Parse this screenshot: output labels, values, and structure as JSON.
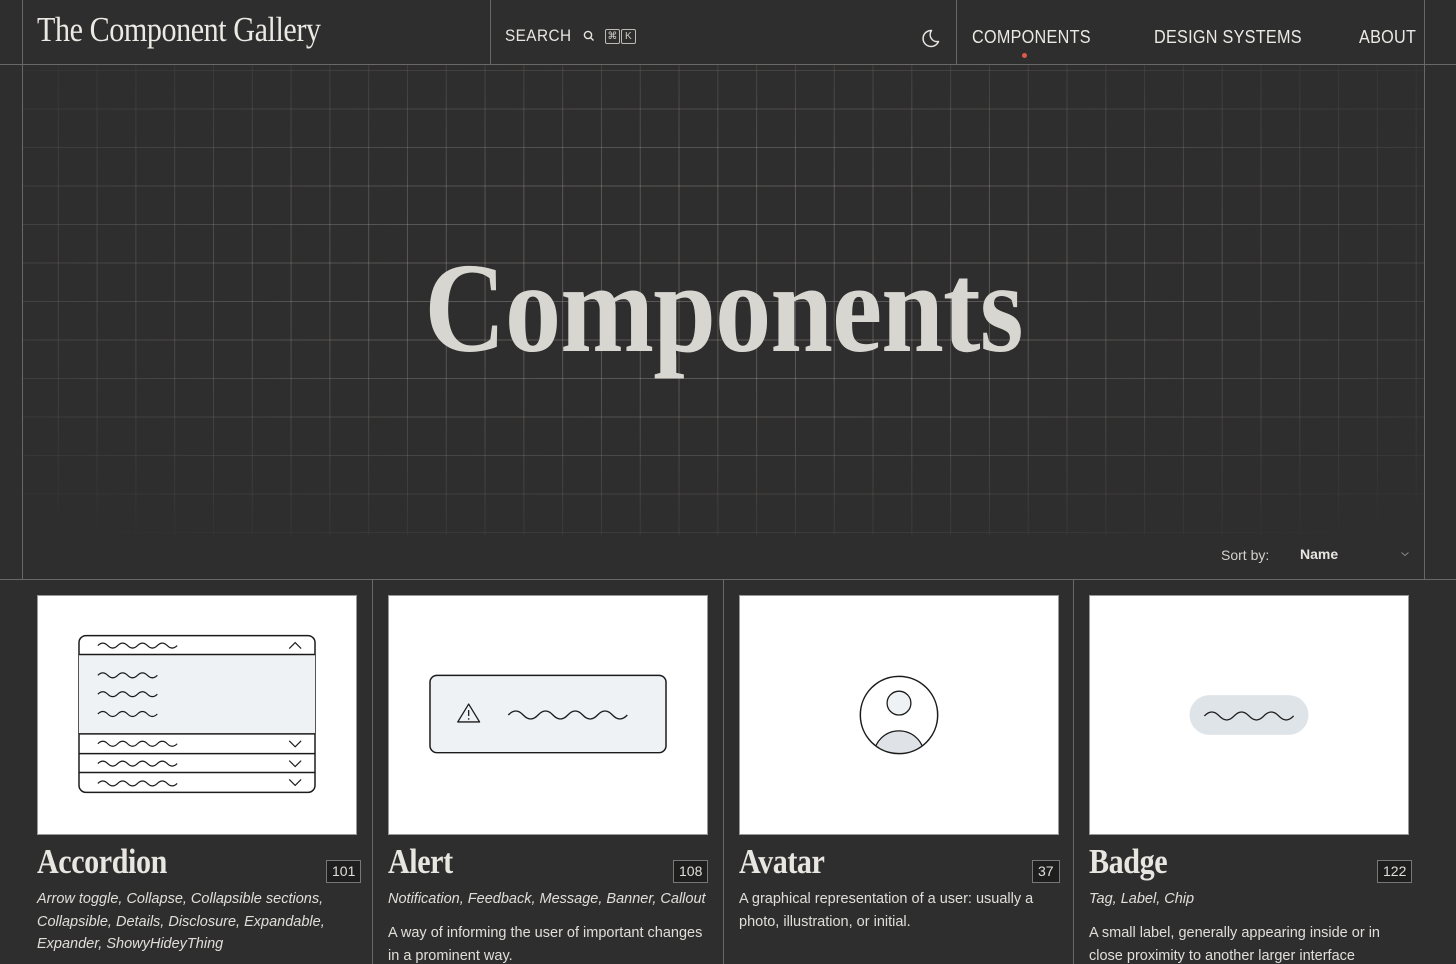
{
  "header": {
    "brand": "The Component Gallery",
    "search_label": "SEARCH",
    "search_shortcut": [
      "⌘",
      "K"
    ],
    "nav": [
      {
        "label": "COMPONENTS",
        "active": true
      },
      {
        "label": "DESIGN SYSTEMS",
        "active": false
      },
      {
        "label": "ABOUT",
        "active": false
      }
    ],
    "icons": {
      "search": "search-icon",
      "theme": "moon-icon"
    }
  },
  "hero": {
    "title": "Components"
  },
  "sort": {
    "label": "Sort by:",
    "value": "Name"
  },
  "cards": [
    {
      "title": "Accordion",
      "count": "101",
      "aliases": "Arrow toggle, Collapse, Collapsible sections, Collapsible, Details, Disclosure, Expandable, Expander, ShowyHideyThing",
      "description": ""
    },
    {
      "title": "Alert",
      "count": "108",
      "aliases": "Notification, Feedback, Message, Banner, Callout",
      "description": "A way of informing the user of important changes in a prominent way."
    },
    {
      "title": "Avatar",
      "count": "37",
      "aliases": "",
      "description": "A graphical representation of a user: usually a photo, illustration, or initial."
    },
    {
      "title": "Badge",
      "count": "122",
      "aliases": "Tag, Label, Chip",
      "description": "A small label, generally appearing inside or in close proximity to another larger interface component,"
    }
  ],
  "colors": {
    "background": "#2f2e2e",
    "line": "#6a6866",
    "text": "#e4e2dd",
    "active_dot": "#e0584a",
    "thumb_fill": "#eef2f5"
  }
}
